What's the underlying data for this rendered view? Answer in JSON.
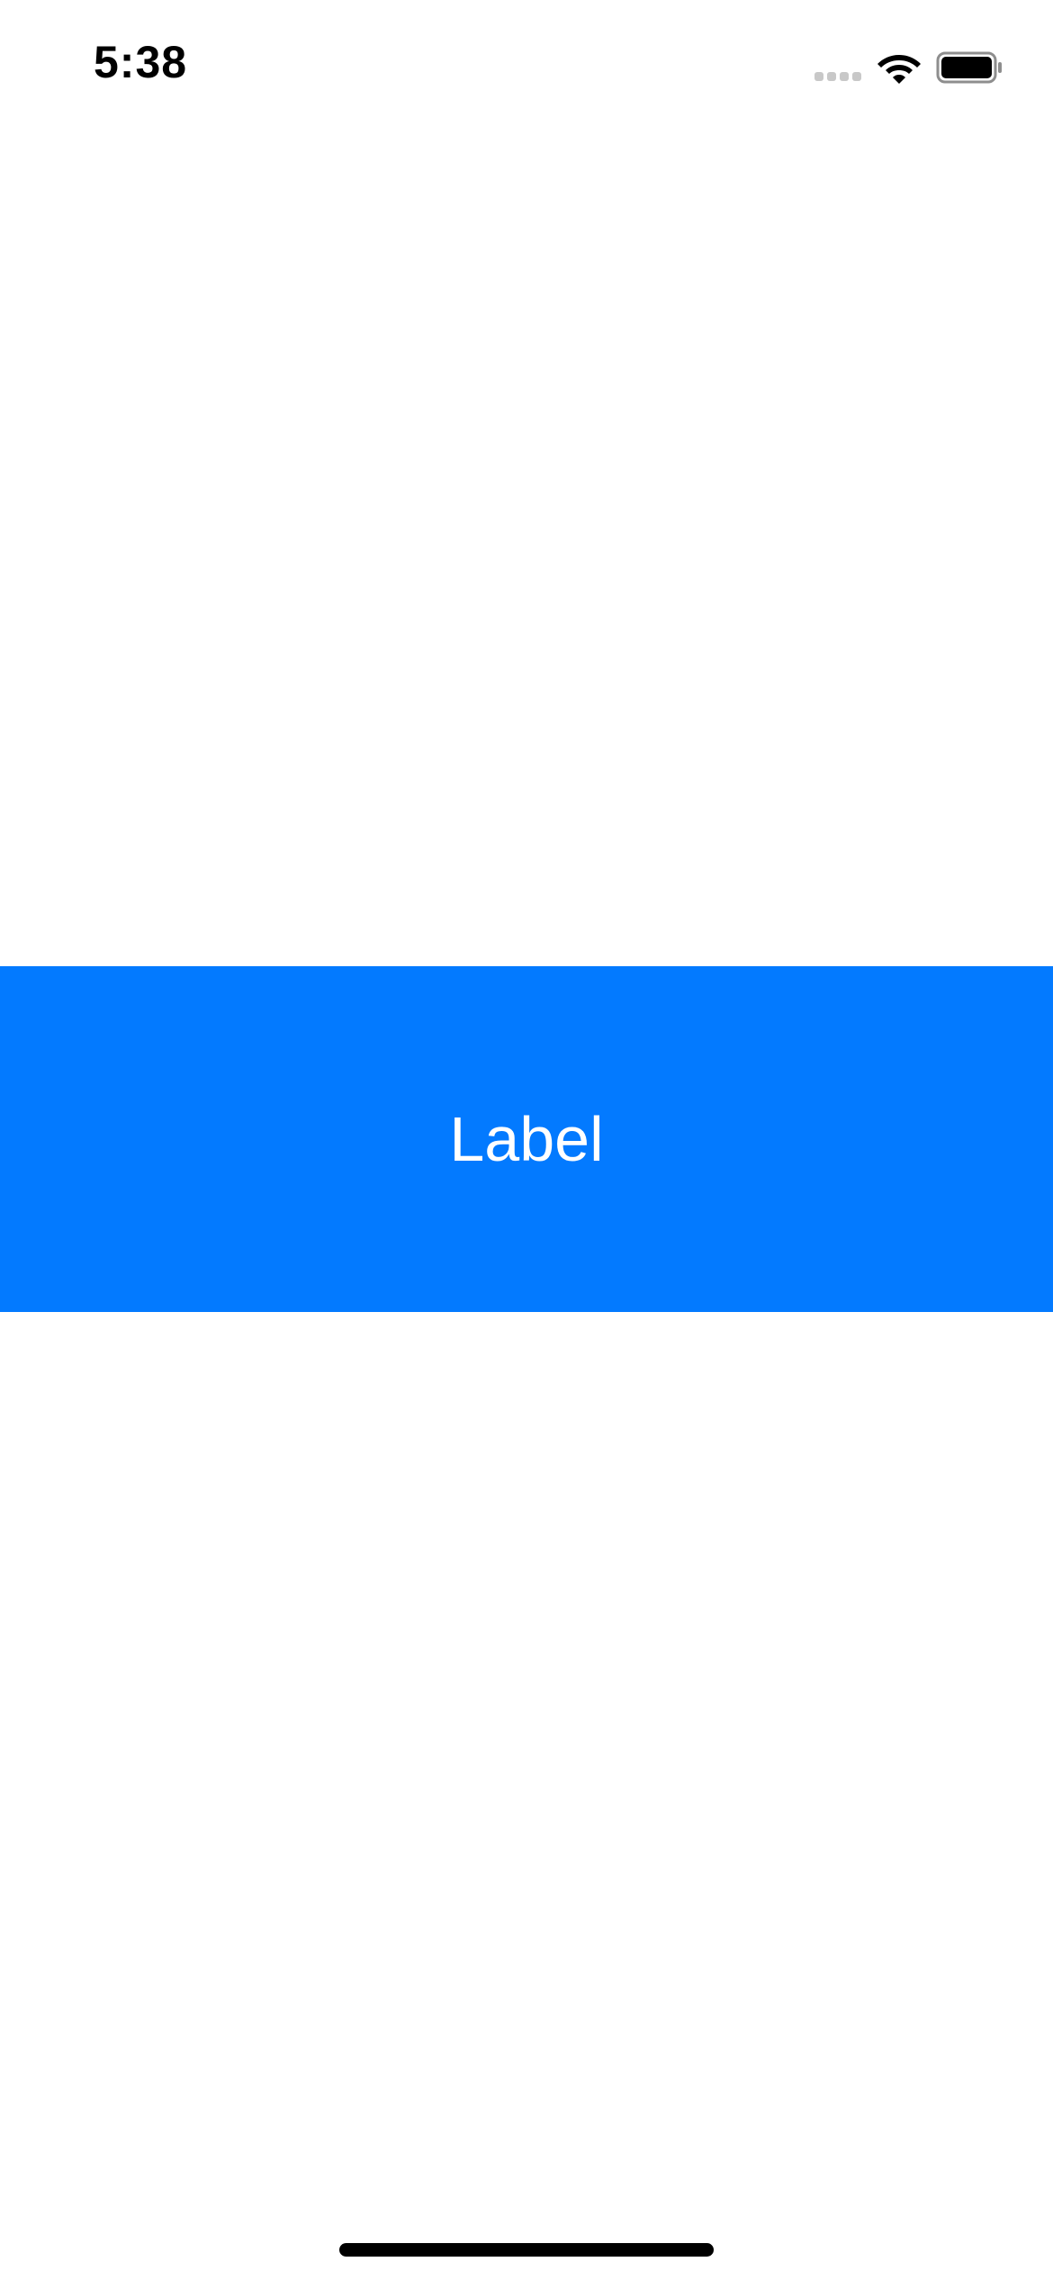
{
  "status_bar": {
    "time": "5:38",
    "signal_icon": "cellular-signal-icon",
    "wifi_icon": "wifi-icon",
    "battery_icon": "battery-icon",
    "battery_level": 1.0
  },
  "main": {
    "label_text": "Label",
    "band_color": "#037aff",
    "text_color": "#ffffff"
  },
  "colors": {
    "background": "#ffffff",
    "accent": "#037aff",
    "home_indicator": "#000000"
  },
  "home_indicator_icon": "home-indicator"
}
